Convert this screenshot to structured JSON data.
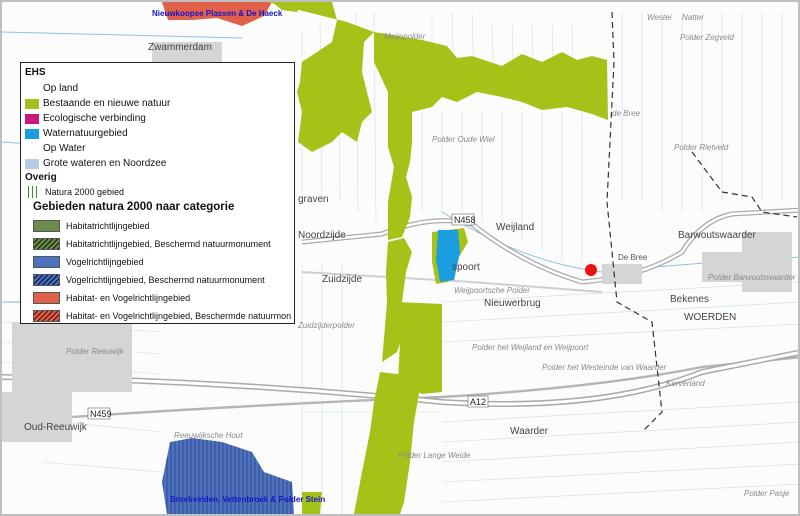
{
  "map": {
    "place_labels": {
      "zwammerdam": "Zwammerdam",
      "meijepolder": "Meijepolder",
      "westei": "Westei",
      "natter": "Natter",
      "polder_zegveld": "Polder Zegveld",
      "polder_rietveld": "Polder Rietveld",
      "polder_oude_wiel": "Polder Oude Wiel",
      "de_bree_top": "de Bree",
      "graven": "graven",
      "noordzijde": "Noordzijde",
      "weijland": "Weijland",
      "zuidzijde": "Zuidzijde",
      "spoort": "spoort",
      "weijpoortsche_polder": "Weijpoortsche Polder",
      "nieuwerbrug": "Nieuwerbrug",
      "de_bree": "De Bree",
      "barwoutswaarder": "Barwoutswaarder",
      "polder_barwoutswaarder": "Polder Barwoutswaarder",
      "bekenes": "Bekenes",
      "woerden": "WOERDEN",
      "zuidzijderpolder": "Zuidzijderpolder",
      "polder_reeuwijk": "Polder Reeuwijk",
      "polder_het_weijland": "Polder het Weijland en Weijpoort",
      "polder_het_westeinde": "Polder het Westeinde van Waarder",
      "kerverland": "Kerverland",
      "oud_reeuwijk": "Oud-Reeuwijk",
      "reeuwijksche_hout": "Reeuwijksche Hout",
      "waarder": "Waarder",
      "polder_lange_weide": "Polder Lange Weide",
      "polder_pasje": "Polder Pasje"
    },
    "road_labels": {
      "n458": "N458",
      "n459": "N459",
      "a12": "A12"
    },
    "natura_labels": {
      "top": "Nieuwkoopse Plassen & De Haeck",
      "bottom": "Broekvelden, Vettenbroek & Polder Stein"
    },
    "colors": {
      "nature": "#a5c219",
      "water": "#1a9ee0",
      "bird_area": "#4d72c0",
      "habitat_bird": "#e0604a",
      "marker": "#ee1111"
    }
  },
  "legend": {
    "title_ehs": "EHS",
    "op_land": "Op land",
    "bestaande": "Bestaande en nieuwe natuur",
    "ecologische": "Ecologische verbinding",
    "waternatuur": "Waternatuurgebied",
    "op_water": "Op Water",
    "grote_wateren": "Grote wateren en Noordzee",
    "overig": "Overig",
    "natura_gebied": "Natura 2000 gebied",
    "categorie_title": "Gebieden natura 2000 naar categorie",
    "habitat": "Habitatrichtlijngebied",
    "habitat_bm": "Habitatrichtlijngebied, Beschermd natuurmonument",
    "vogel": "Vogelrichtlijngebied",
    "vogel_bm": "Vogelrichtlijngebied, Beschermd natuurmonument",
    "hab_vogel": "Habitat- en Vogelrichtlijngebied",
    "hab_vogel_bm": "Habitat- en Vogelrichtlijngebied, Beschermde natuurmonu",
    "colors": {
      "bestaande": "#a5c219",
      "ecologische": "#c8177e",
      "waternatuur": "#1a9ee0",
      "grote_wateren": "#b4cce8",
      "habitat": "#6b8c4a",
      "vogel": "#4d72c0",
      "hab_vogel": "#e0604a"
    }
  }
}
